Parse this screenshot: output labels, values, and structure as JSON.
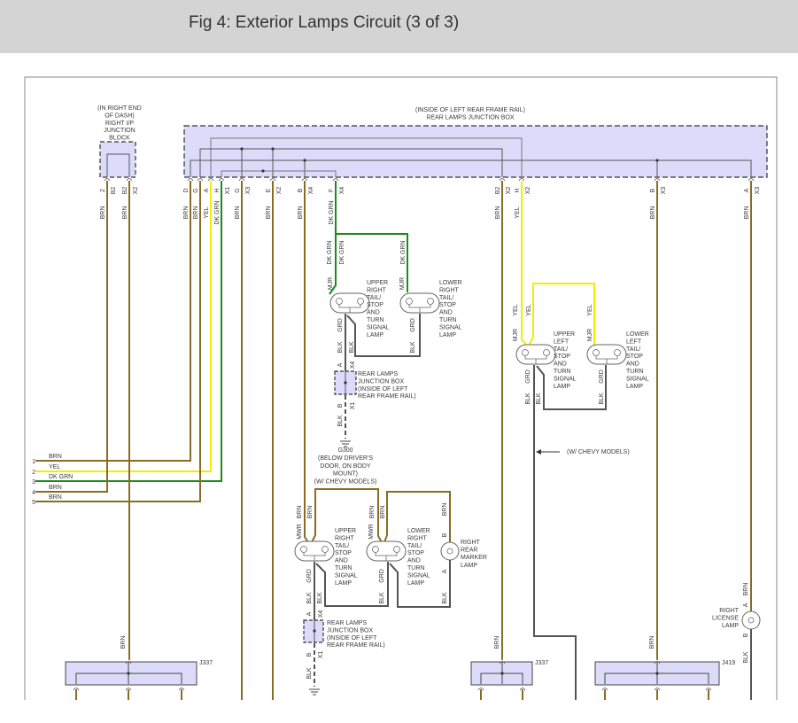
{
  "header": {
    "title": "Fig 4: Exterior Lamps Circuit (3 of 3)"
  },
  "colors": {
    "brn": "#8a6d22",
    "yel": "#f2ee00",
    "dkgrn": "#1d8a1d",
    "blk": "#555555",
    "box_fill": "#dcdcfa"
  },
  "ip_block": {
    "label": [
      "(IN RIGHT END",
      "OF DASH)",
      "RIGHT I/P",
      "JUNCTION",
      "BLOCK"
    ],
    "pins": [
      {
        "pin": "2",
        "conn": "B2",
        "wire": "BRN"
      },
      {
        "pin": "B2",
        "conn": "X2",
        "wire": "BRN"
      }
    ]
  },
  "rear_box": {
    "label": [
      "(INSIDE OF LEFT REAR FRAME RAIL)",
      "REAR LAMPS JUNCTION BOX"
    ],
    "pins": [
      {
        "pin": "D",
        "conn": "",
        "wire": "BRN"
      },
      {
        "pin": "G",
        "conn": "",
        "wire": "BRN"
      },
      {
        "pin": "A",
        "conn": "",
        "wire": "YEL"
      },
      {
        "pin": "H",
        "conn": "X1",
        "wire": "DK GRN"
      },
      {
        "pin": "G",
        "conn": "X3",
        "wire": "BRN"
      },
      {
        "pin": "E",
        "conn": "X2",
        "wire": "BRN"
      },
      {
        "pin": "B",
        "conn": "X4",
        "wire": "BRN"
      },
      {
        "pin": "F",
        "conn": "X4",
        "wire": "DK GRN"
      },
      {
        "pin": "B2",
        "conn": "X2",
        "wire": "BRN"
      },
      {
        "pin": "H",
        "conn": "X2",
        "wire": "YEL"
      },
      {
        "pin": "B",
        "conn": "X3",
        "wire": "BRN"
      },
      {
        "pin": "A",
        "conn": "X3",
        "wire": "BRN"
      }
    ]
  },
  "harness_rows": [
    {
      "num": "1",
      "color": "BRN"
    },
    {
      "num": "2",
      "color": "YEL"
    },
    {
      "num": "3",
      "color": "DK GRN"
    },
    {
      "num": "4",
      "color": "BRN"
    },
    {
      "num": "5",
      "color": "BRN"
    }
  ],
  "lamps": {
    "upper_right_1": {
      "label": [
        "UPPER",
        "RIGHT",
        "TAIL/",
        "STOP",
        "AND",
        "TURN",
        "SIGNAL",
        "LAMP"
      ],
      "feed": "MJR",
      "ground": "GRD"
    },
    "lower_right_1": {
      "label": [
        "LOWER",
        "RIGHT",
        "TAIL/",
        "STOP",
        "AND",
        "TURN",
        "SIGNAL",
        "LAMP"
      ],
      "feed": "MJR",
      "ground": "GRD"
    },
    "upper_left": {
      "label": [
        "UPPER",
        "LEFT",
        "TAIL/",
        "STOP",
        "AND",
        "TURN",
        "SIGNAL",
        "LAMP"
      ],
      "feed": "MJR",
      "ground": "GRD"
    },
    "lower_left": {
      "label": [
        "LOWER",
        "LEFT",
        "TAIL/",
        "STOP",
        "AND",
        "TURN",
        "SIGNAL",
        "LAMP"
      ],
      "feed": "MJR",
      "ground": "GRD"
    },
    "upper_right_2": {
      "label": [
        "UPPER",
        "RIGHT",
        "TAIL/",
        "STOP",
        "AND",
        "TURN",
        "SIGNAL",
        "LAMP"
      ],
      "feed": "MWR",
      "ground": "GRD"
    },
    "lower_right_2": {
      "label": [
        "LOWER",
        "RIGHT",
        "TAIL/",
        "STOP",
        "AND",
        "TURN",
        "SIGNAL",
        "LAMP"
      ],
      "feed": "MWR",
      "ground": "GRD"
    },
    "marker": {
      "label": [
        "RIGHT",
        "REAR",
        "MARKER",
        "LAMP"
      ],
      "pin_b": "B",
      "pin_a": "A"
    },
    "license": {
      "label": [
        "RIGHT",
        "LICENSE",
        "LAMP"
      ],
      "pin_a": "A",
      "pin_b": "B"
    }
  },
  "wire_labels": {
    "brn": "BRN",
    "yel": "YEL",
    "dkgrn": "DK GRN",
    "blk": "BLK"
  },
  "mini_box": {
    "label": [
      "REAR LAMPS",
      "JUNCTION BOX",
      "(INSIDE OF LEFT",
      "REAR FRAME RAIL)"
    ],
    "pin_in": "A",
    "conn_in": "X4",
    "pin_out": "B",
    "conn_out": "X1"
  },
  "ground": {
    "id": "G300",
    "label": [
      "(BELOW DRIVER'S",
      "DOOR, ON BODY",
      "MOUNT)",
      "(W/ CHEVY MODELS)"
    ]
  },
  "note": "(W/ CHEVY MODELS)",
  "connectors": [
    {
      "id": "J337"
    },
    {
      "id": "J337"
    },
    {
      "id": "J419"
    }
  ]
}
